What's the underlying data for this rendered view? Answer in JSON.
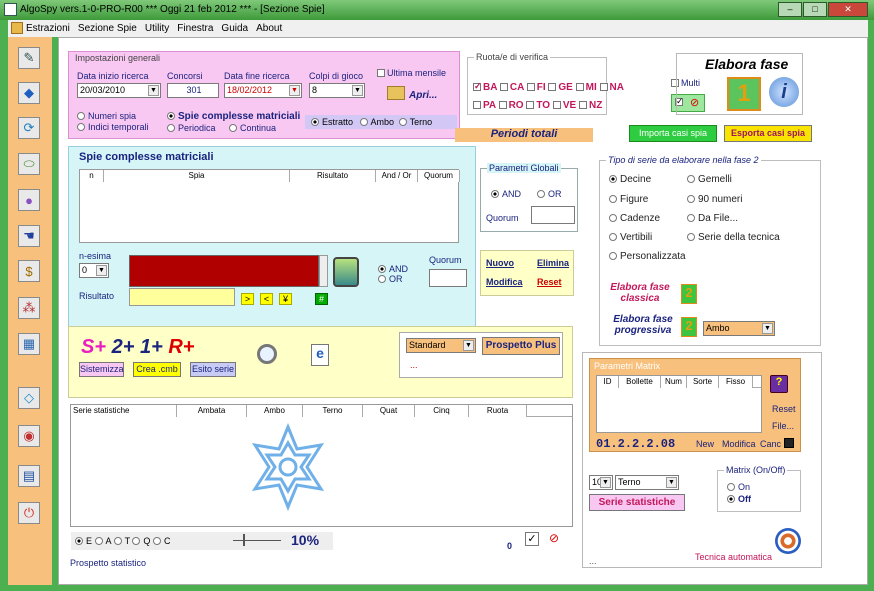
{
  "window": {
    "title": "AlgoSpy vers.1-0-PRO-R00  ***  Oggi 21 feb 2012  ***  - [Sezione Spie]",
    "min": "–",
    "max": "□",
    "close": "✕"
  },
  "menu": [
    "Estrazioni",
    "Sezione Spie",
    "Utility",
    "Finestra",
    "Guida",
    "About"
  ],
  "sidebar_icons": [
    "pencil-icon",
    "cube-icon",
    "refresh-icon",
    "pills-icon",
    "bulb-icon",
    "hand-icon",
    "dollar-icon",
    "network-icon",
    "calendar-icon",
    "diamond-icon",
    "target-icon",
    "book-icon",
    "power-icon"
  ],
  "general": {
    "title": "Impostazioni generali",
    "data_inizio_label": "Data inizio ricerca",
    "data_inizio": "20/03/2010",
    "concorsi_label": "Concorsi",
    "concorsi": "301",
    "data_fine_label": "Data fine ricerca",
    "data_fine": "18/02/2012",
    "colpi_label": "Colpi di gioco",
    "colpi": "8",
    "ultima_mensile": "Ultima mensile",
    "apri": "Apri...",
    "numeri_spia": "Numeri spia",
    "indici_temporali": "Indici temporali",
    "spie_complesse": "Spie complesse matriciali",
    "periodica": "Periodica",
    "continua": "Continua",
    "estratto": "Estratto",
    "ambo": "Ambo",
    "terno": "Terno"
  },
  "ruote": {
    "title": "Ruota/e di verifica",
    "row1": [
      "BA",
      "CA",
      "FI",
      "GE",
      "MI",
      "NA"
    ],
    "row2": [
      "PA",
      "RO",
      "TO",
      "VE",
      "NZ"
    ],
    "multi": "Multi",
    "periodi_totali": "Periodi totali"
  },
  "elabora": {
    "title": "Elabora fase",
    "num": "1",
    "info": "i"
  },
  "import_btn": "Importa casi spia",
  "export_btn": "Esporta casi spia",
  "spie": {
    "title": "Spie complesse matriciali",
    "columns": [
      "n",
      "Spia",
      "Risultato",
      "And / Or",
      "Quorum"
    ],
    "params_title": "Parametri Globali",
    "and": "AND",
    "or": "OR",
    "quorum": "Quorum",
    "n_esima": "n-esima",
    "n_val": "0",
    "risultato": "Risultato",
    "quorum2": "Quorum",
    "nuovo": "Nuovo",
    "elimina": "Elimina",
    "modifica": "Modifica",
    "reset": "Reset",
    "ops": [
      ">",
      "<",
      "¥"
    ],
    "hash": "#"
  },
  "serie": {
    "title": "Tipo di serie da elaborare nella fase 2",
    "left": [
      "Decine",
      "Figure",
      "Cadenze",
      "Vertibili",
      "Personalizzata"
    ],
    "right": [
      "Gemelli",
      "90 numeri",
      "Da File...",
      "Serie della tecnica"
    ],
    "classica": "Elabora fase classica",
    "progressiva": "Elabora fase progressiva",
    "n2": "2",
    "ambo": "Ambo"
  },
  "sistema": {
    "s": "S+",
    "n2": "2+",
    "n1": "1+",
    "r": "R+",
    "sistemizza": "Sistemizza",
    "crea": "Crea .cmb",
    "esito": "Esito serie",
    "standard": "Standard",
    "prospetto_plus": "Prospetto Plus",
    "dots": "..."
  },
  "stats": {
    "columns": [
      "Serie statistiche",
      "Ambata",
      "Ambo",
      "Terno",
      "Quat",
      "Cinq",
      "Ruota"
    ],
    "radios": [
      "E",
      "A",
      "T",
      "Q",
      "C"
    ],
    "percent": "10%",
    "zero": "0",
    "prospetto": "Prospetto statistico"
  },
  "matrix": {
    "title": "Parametri Matrix",
    "columns": [
      "ID",
      "Bollette",
      "Num",
      "Sorte",
      "Fisso"
    ],
    "reset": "Reset",
    "file": "File...",
    "code": "01.2.2.2.08",
    "new": "New",
    "modifica": "Modifica",
    "canc": "Canc",
    "sel_n": "10",
    "sel_sorte": "Terno",
    "serie_btn": "Serie statistiche",
    "onoff_title": "Matrix (On/Off)",
    "on": "On",
    "off": "Off",
    "tecnica": "Tecnica automatica",
    "dots": "..."
  }
}
